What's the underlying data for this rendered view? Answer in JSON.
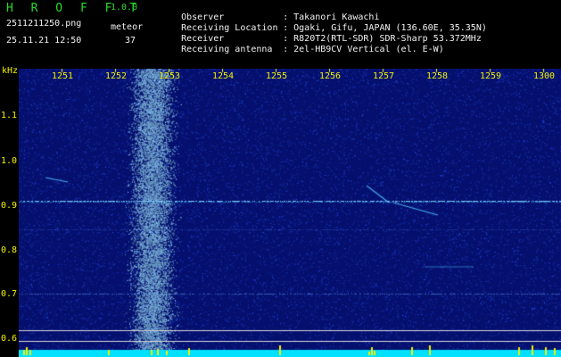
{
  "header": {
    "app_title": "H R O F F T",
    "app_version": "1.0.0",
    "file_name": "2511211250.png",
    "timestamp": "25.11.21 12:50",
    "meteor_label": "meteor",
    "meteor_count": "37"
  },
  "info": [
    {
      "label": "Observer",
      "value": ": Takanori Kawachi"
    },
    {
      "label": "Receiving Location",
      "value": ": Ogaki, Gifu, JAPAN (136.60E, 35.35N)"
    },
    {
      "label": "Receiver",
      "value": ": R820T2(RTL-SDR) SDR-Sharp 53.372MHz"
    },
    {
      "label": "Receiving antenna",
      "value": ": 2el-HB9CV Vertical (el. E-W)"
    }
  ],
  "spectrogram": {
    "y_unit": "kHz",
    "y_ticks": [
      "1.1",
      "1.0",
      "0.9",
      "0.8",
      "0.7",
      "0.6"
    ],
    "x_ticks": [
      "1251",
      "1252",
      "1253",
      "1254",
      "1255",
      "1256",
      "1257",
      "1258",
      "1259",
      "1300"
    ],
    "colors": {
      "background": "#05106e",
      "noise": "#1e3cc8",
      "signal": "#50c8ff",
      "tick": "#f2f200",
      "baseline": "#00e0ff"
    }
  }
}
